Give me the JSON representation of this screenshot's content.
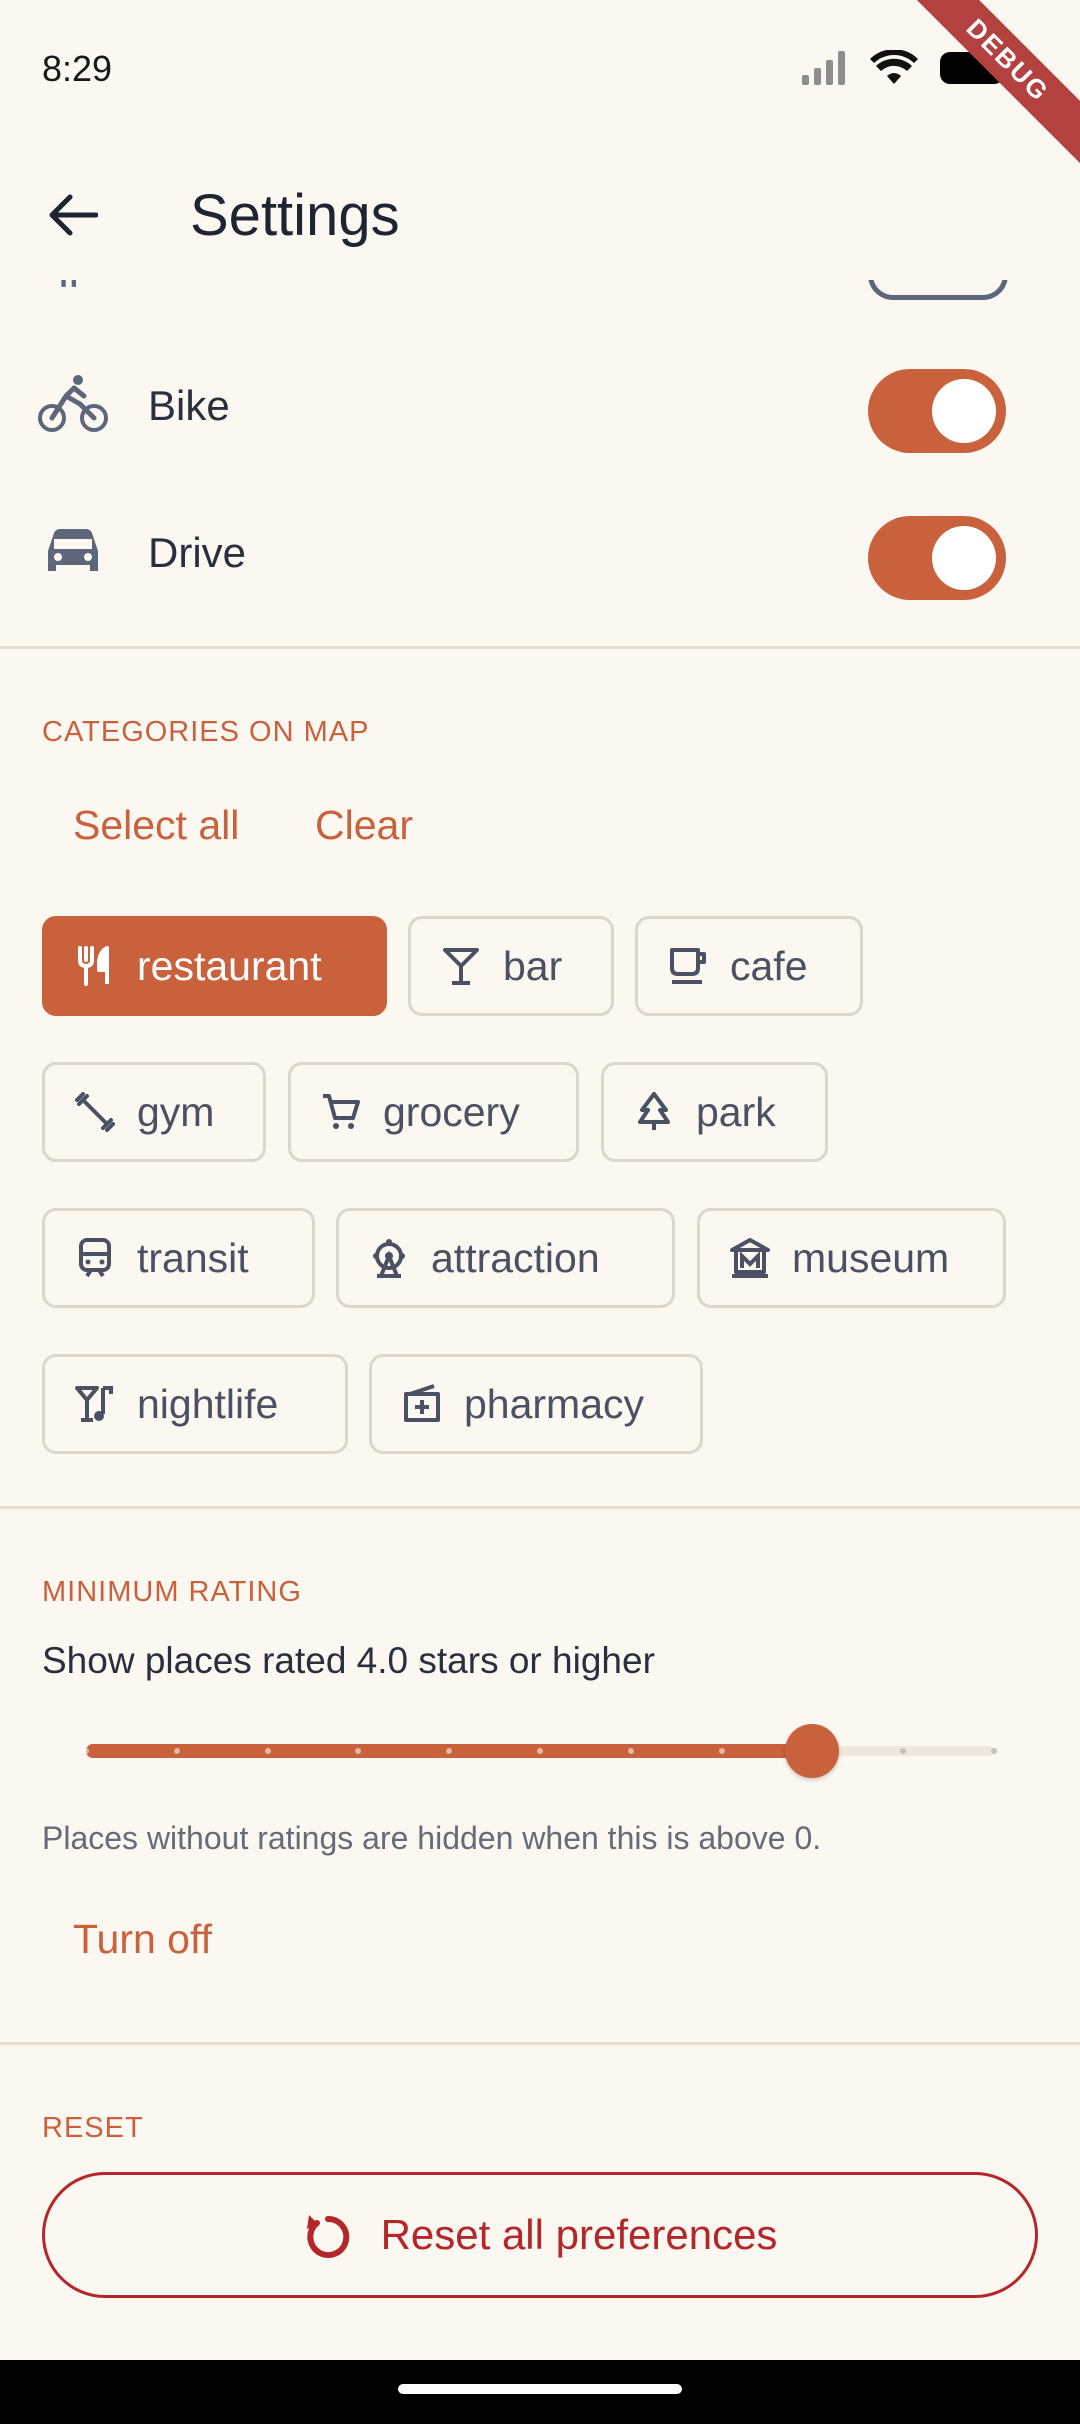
{
  "status_bar": {
    "time": "8:29",
    "debug_label": "DEBUG"
  },
  "app_bar": {
    "title": "Settings"
  },
  "transport_modes": [
    {
      "label": "Bike",
      "icon": "bike-icon",
      "enabled": true
    },
    {
      "label": "Drive",
      "icon": "car-icon",
      "enabled": true
    }
  ],
  "categories": {
    "heading": "CATEGORIES ON MAP",
    "select_all_label": "Select all",
    "clear_label": "Clear",
    "chips": [
      {
        "label": "restaurant",
        "icon": "restaurant-icon",
        "selected": true
      },
      {
        "label": "bar",
        "icon": "cocktail-icon",
        "selected": false
      },
      {
        "label": "cafe",
        "icon": "coffee-icon",
        "selected": false
      },
      {
        "label": "gym",
        "icon": "dumbbell-icon",
        "selected": false
      },
      {
        "label": "grocery",
        "icon": "cart-icon",
        "selected": false
      },
      {
        "label": "park",
        "icon": "tree-icon",
        "selected": false
      },
      {
        "label": "transit",
        "icon": "train-icon",
        "selected": false
      },
      {
        "label": "attraction",
        "icon": "ferris-wheel-icon",
        "selected": false
      },
      {
        "label": "museum",
        "icon": "museum-icon",
        "selected": false
      },
      {
        "label": "nightlife",
        "icon": "nightlife-icon",
        "selected": false
      },
      {
        "label": "pharmacy",
        "icon": "pharmacy-icon",
        "selected": false
      }
    ]
  },
  "rating": {
    "heading": "MINIMUM RATING",
    "description": "Show places rated 4.0 stars or higher",
    "value": 4.0,
    "min": 0,
    "max": 5,
    "divisions": 10,
    "hint": "Places without ratings are hidden when this is above 0.",
    "turn_off_label": "Turn off"
  },
  "reset": {
    "heading": "RESET",
    "button_label": "Reset all preferences"
  },
  "colors": {
    "accent": "#C9613C",
    "background": "#FBF7F1",
    "danger": "#B3272A"
  }
}
